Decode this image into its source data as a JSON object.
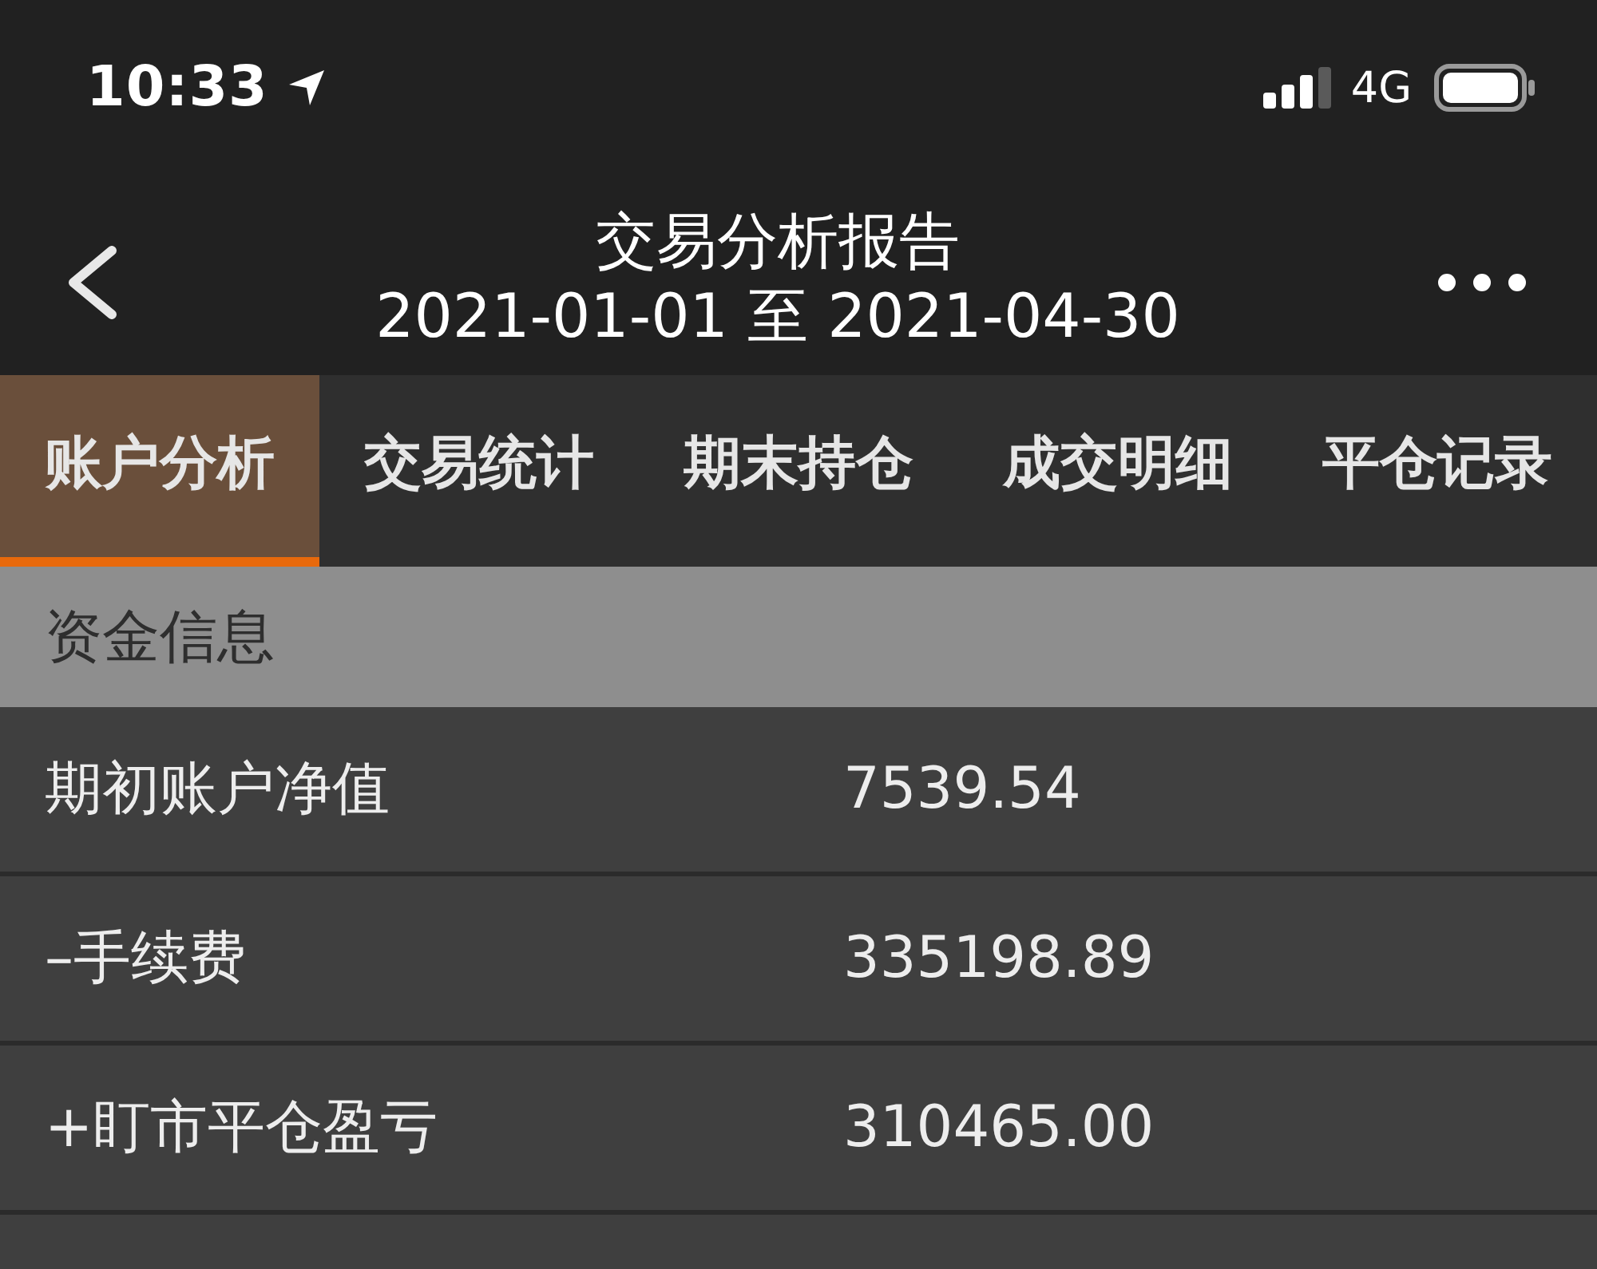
{
  "status_bar": {
    "time": "10:33",
    "network": "4G"
  },
  "nav_bar": {
    "title": "交易分析报告",
    "subtitle": "2021-01-01 至 2021-04-30"
  },
  "tabs": [
    {
      "label": "账户分析",
      "selected": true
    },
    {
      "label": "交易统计",
      "selected": false
    },
    {
      "label": "期末持仓",
      "selected": false
    },
    {
      "label": "成交明细",
      "selected": false
    },
    {
      "label": "平仓记录",
      "selected": false
    }
  ],
  "section": {
    "title": "资金信息",
    "rows": [
      {
        "label": "期初账户净值",
        "value": "7539.54"
      },
      {
        "label": "–手续费",
        "value": "335198.89"
      },
      {
        "label": "+盯市平仓盈亏",
        "value": "310465.00"
      }
    ]
  }
}
